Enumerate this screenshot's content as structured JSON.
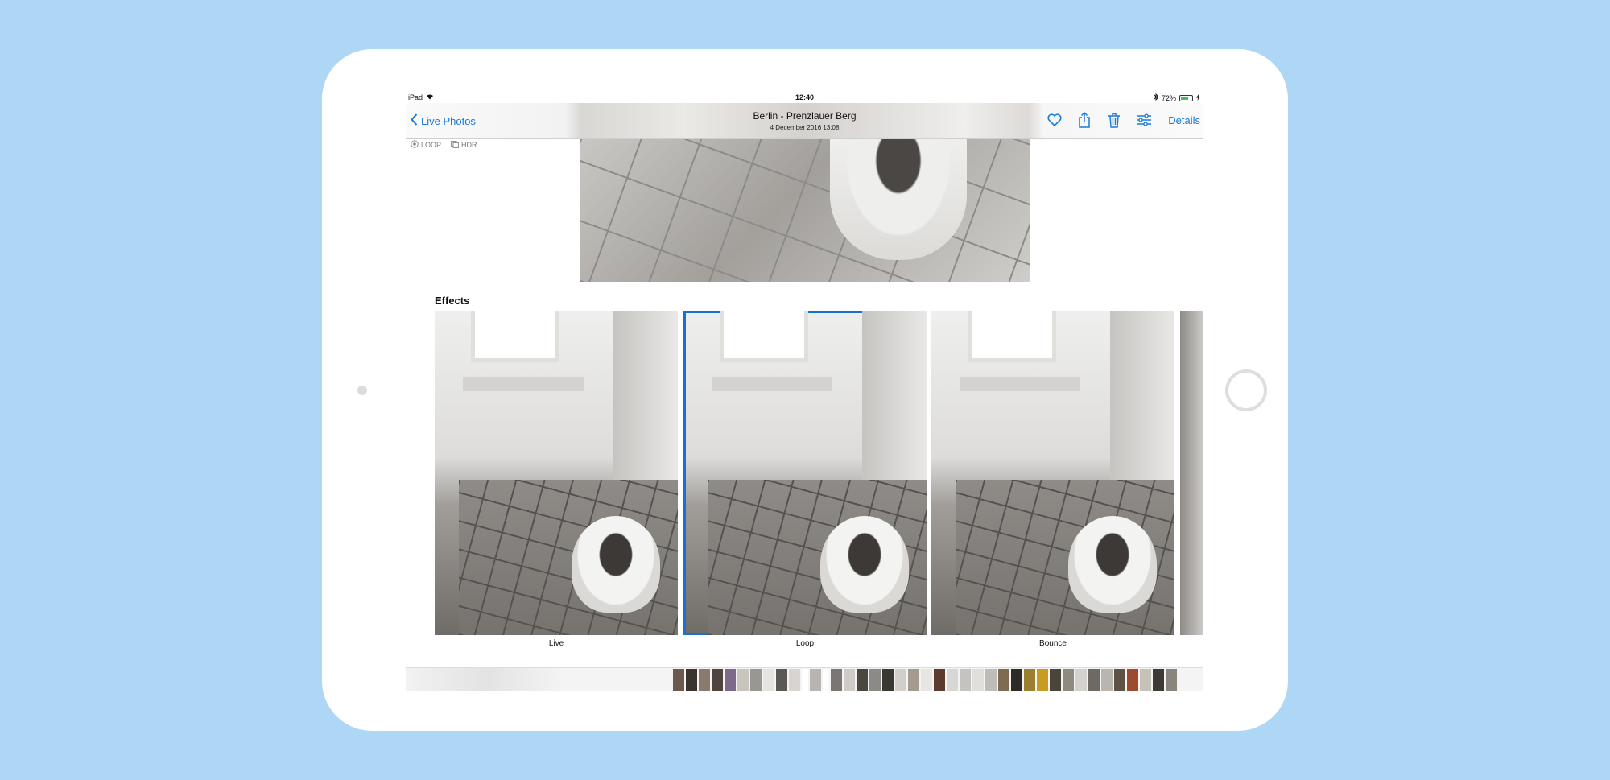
{
  "status": {
    "device": "iPad",
    "time": "12:40",
    "battery": "72%",
    "battery_level": 0.72
  },
  "nav": {
    "back_label": "Live Photos",
    "title": "Berlin - Prenzlauer Berg",
    "subtitle": "4 December 2016  13:08",
    "details_label": "Details"
  },
  "badges": {
    "loop": "LOOP",
    "hdr": "HDR"
  },
  "effects": {
    "heading": "Effects",
    "items": [
      {
        "label": "Live",
        "selected": false
      },
      {
        "label": "Loop",
        "selected": true
      },
      {
        "label": "Bounce",
        "selected": false
      }
    ]
  },
  "colors": {
    "accent": "#1a7ad8",
    "selection": "#1a6fd0",
    "background": "#aed6f5"
  }
}
